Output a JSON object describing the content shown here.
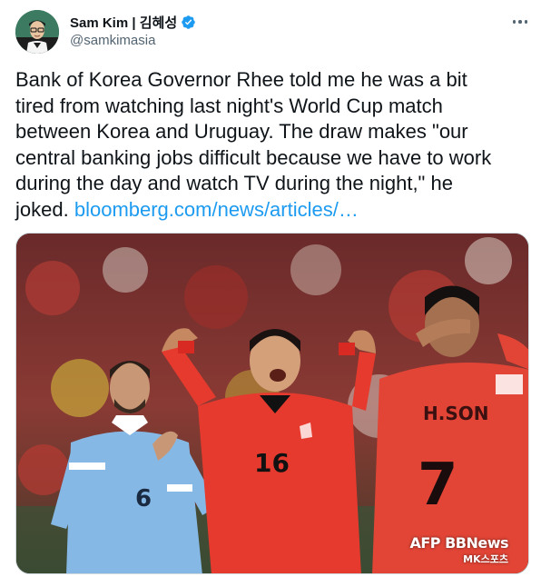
{
  "author": {
    "display_name": "Sam Kim | 김혜성",
    "handle": "@samkimasia",
    "verified": true,
    "avatar_icon": "person-avatar-icon"
  },
  "tweet": {
    "text_lines": [
      "Bank of Korea Governor Rhee told me he was a bit",
      "tired from watching last night's World Cup match",
      "between Korea and Uruguay. The draw makes \"our",
      "central banking jobs difficult because we have to work",
      "during the day and watch TV during the night,\" he",
      "joked."
    ],
    "link_text": "bloomberg.com/news/articles/…"
  },
  "media": {
    "description_icon": "soccer-players-photo",
    "watermark": "AFP BBNews",
    "watermark_sub": "MK스포츠",
    "jersey_numbers": [
      "6",
      "16",
      "7"
    ],
    "jersey_name": "H.SON"
  },
  "colors": {
    "link": "#1d9bf0",
    "verified": "#1d9bf0",
    "secondary_text": "#536471",
    "korea_red": "#e63a2e",
    "uruguay_blue": "#7fb2e2"
  }
}
